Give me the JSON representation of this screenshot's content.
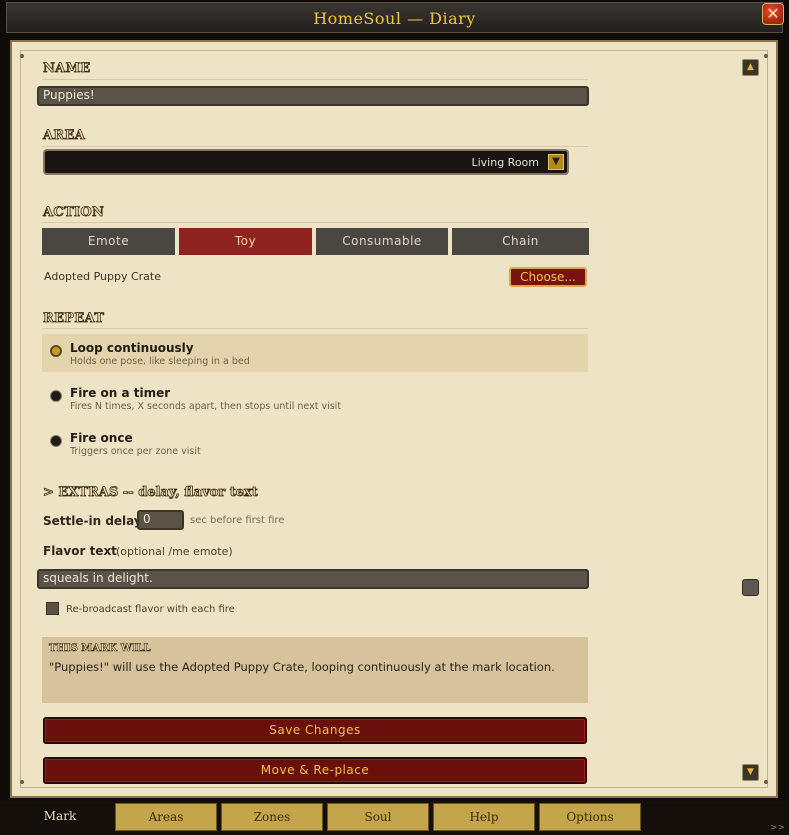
{
  "window": {
    "title": "HomeSoul — Diary",
    "close_icon": "close-icon"
  },
  "name": {
    "heading": "NAME",
    "value": "Puppies!"
  },
  "area": {
    "heading": "AREA",
    "selected": "Living Room"
  },
  "action": {
    "heading": "ACTION",
    "segments": [
      "Emote",
      "Toy",
      "Consumable",
      "Chain"
    ],
    "active": "Toy",
    "item": "Adopted Puppy Crate",
    "choose_label": "Choose..."
  },
  "repeat": {
    "heading": "REPEAT",
    "options": [
      {
        "title": "Loop continuously",
        "desc": "Holds one pose, like sleeping in a bed",
        "selected": true
      },
      {
        "title": "Fire on a timer",
        "desc": "Fires N times, X seconds apart, then stops until next visit",
        "selected": false
      },
      {
        "title": "Fire once",
        "desc": "Triggers once per zone visit",
        "selected": false
      }
    ]
  },
  "extras": {
    "heading": "> EXTRAS -- delay, flavor text",
    "settle_label": "Settle-in delay:",
    "settle_value": "0",
    "settle_hint": "sec before first fire",
    "flavor_label": "Flavor text",
    "flavor_hint": "(optional /me emote)",
    "flavor_value": "squeals in delight.",
    "rebroadcast_label": "Re-broadcast flavor with each fire",
    "rebroadcast_checked": false
  },
  "summary": {
    "heading": "THIS MARK WILL",
    "text": "\"Puppies!\" will use the Adopted Puppy Crate, looping continuously at the mark location."
  },
  "buttons": {
    "save": "Save Changes",
    "move": "Move & Re-place"
  },
  "tabs": [
    "Mark",
    "Areas",
    "Zones",
    "Soul",
    "Help",
    "Options"
  ],
  "active_tab": "Mark",
  "colors": {
    "accent_gold": "#f2c63c",
    "active_red": "#8f2320",
    "parchment": "#efe3c5"
  }
}
